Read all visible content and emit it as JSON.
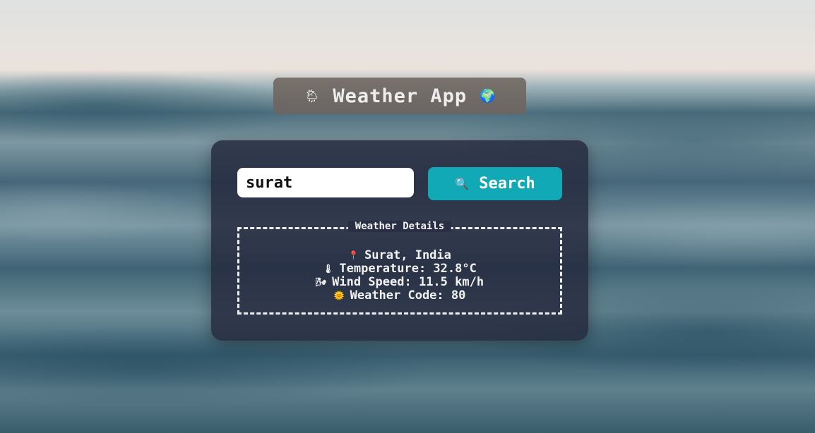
{
  "app": {
    "title": "Weather App",
    "title_left_icon": "sun-behind-rain-cloud-icon",
    "title_right_icon": "globe-icon",
    "title_left_emoji": "🌦",
    "title_right_emoji": "🌍"
  },
  "search": {
    "value": "surat",
    "button_label": "Search",
    "button_emoji": "🔍",
    "button_icon": "magnifier-icon"
  },
  "details": {
    "legend": "Weather Details",
    "location": {
      "emoji": "📍",
      "icon": "pin-icon",
      "text": "Surat, India"
    },
    "temperature": {
      "emoji": "🌡",
      "icon": "thermometer-icon",
      "text": "Temperature: 32.8°C"
    },
    "wind": {
      "emoji": "🌬",
      "icon": "wind-icon",
      "text": "Wind Speed: 11.5 km/h"
    },
    "code": {
      "emoji": "🌞",
      "icon": "sun-icon",
      "text": "Weather Code: 80"
    }
  },
  "colors": {
    "button": "#12a9b7",
    "card": "#262a3e",
    "title_box": "#6e645f"
  }
}
